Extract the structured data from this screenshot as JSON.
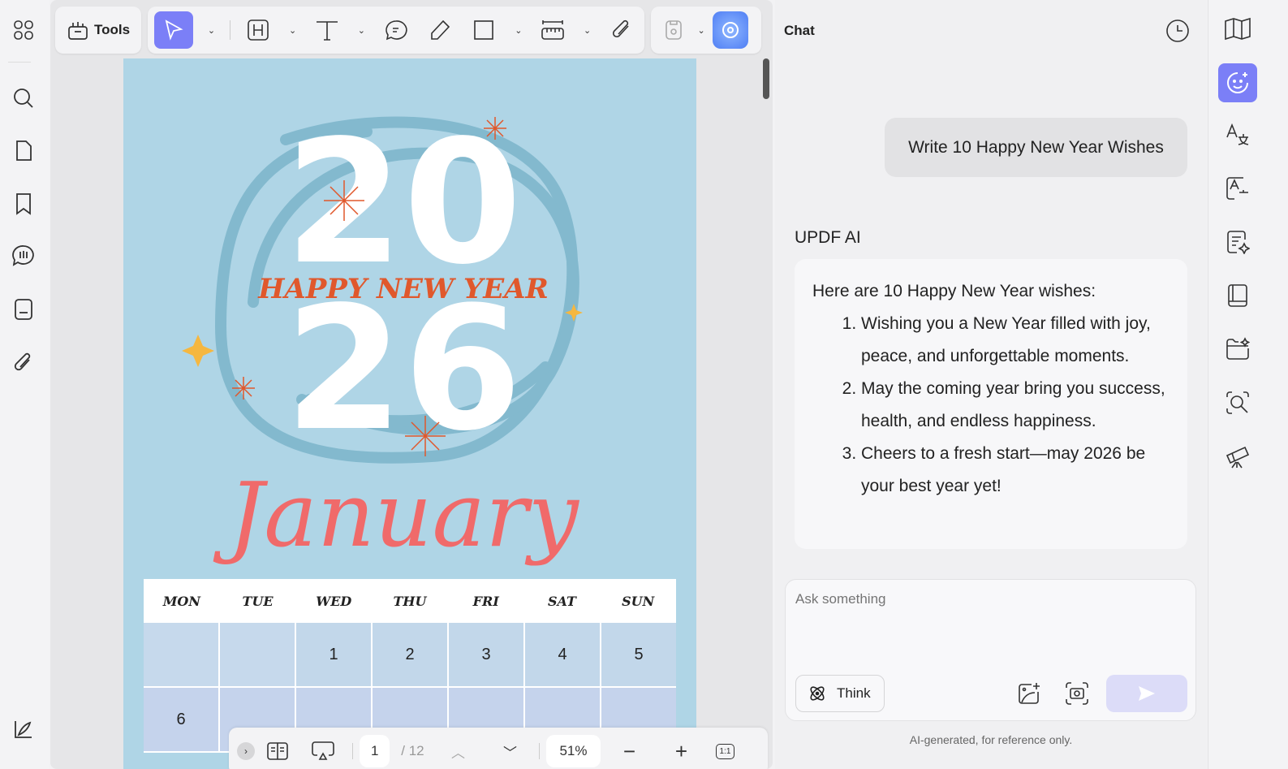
{
  "toolbar": {
    "tools_label": "Tools"
  },
  "document": {
    "art": {
      "year_top": "20",
      "year_bottom": "26",
      "greeting": "HAPPY NEW YEAR",
      "month": "January"
    },
    "calendar": {
      "days": [
        "MON",
        "TUE",
        "WED",
        "THU",
        "FRI",
        "SAT",
        "SUN"
      ],
      "rows": [
        [
          "",
          "",
          "1",
          "2",
          "3",
          "4",
          "5"
        ],
        [
          "6",
          "",
          "",
          "",
          "",
          "",
          ""
        ]
      ]
    }
  },
  "pager": {
    "current_page": "1",
    "total_pages": "/ 12",
    "zoom": "51%",
    "fit_label": "1:1"
  },
  "chat": {
    "title": "Chat",
    "user_message": "Write 10 Happy New Year Wishes",
    "ai_name": "UPDF AI",
    "ai_intro": "Here are 10 Happy New Year wishes:",
    "ai_items": [
      "Wishing you a New Year filled with joy, peace, and unforgettable moments.",
      "May the coming year bring you success, health, and endless happiness.",
      "Cheers to a fresh start—may 2026 be your best year yet!"
    ],
    "input_placeholder": "Ask something",
    "think_label": "Think",
    "disclaimer": "AI-generated, for reference only."
  },
  "colors": {
    "accent": "#7b7ff7",
    "page_bg": "#afd5e6",
    "greeting": "#e0582c",
    "month": "#f06a6a"
  }
}
